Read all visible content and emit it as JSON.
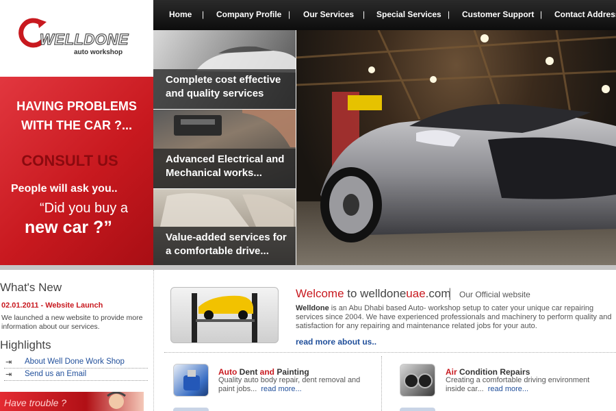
{
  "brand": {
    "name": "WELLDONE",
    "tagline": "auto workshop",
    "red": "#c8191f",
    "dark": "#1a1a1a",
    "link": "#1f4e9a"
  },
  "nav": {
    "items": [
      "Home",
      "Company Profile",
      "Our Services",
      "Special Services",
      "Customer Support",
      "Contact Address"
    ],
    "separator": "|"
  },
  "promo": {
    "line1": "HAVING PROBLEMS",
    "line2": "WITH THE CAR ?...",
    "consult": "CONSULT US",
    "ask": "People will ask you..",
    "quote1": "“Did you buy a",
    "quote2": "new car ?”"
  },
  "features": [
    {
      "caption": "Complete cost effective and quality services"
    },
    {
      "caption": "Advanced Electrical and Mechanical works..."
    },
    {
      "caption": "Value-added services for a comfortable drive..."
    }
  ],
  "sidebar": {
    "whats_new_title": "What's New",
    "news_date": "02.01.2011 - Website Launch",
    "news_body": "We launched a new website to provide more information about our services.",
    "highlights_title": "Highlights",
    "highlights": [
      "About Well Done Work Shop",
      "Send us an Email"
    ],
    "trouble_text": "Have trouble ?"
  },
  "welcome": {
    "title_welcome": "Welcome",
    "title_to": " to welldone",
    "title_uae": "uae",
    "title_com": ".com",
    "bar": "|",
    "subtitle": "Our Official website",
    "brand_bold": "Welldone",
    "body": " is an Abu Dhabi based Auto- workshop setup to cater your unique car repairing services since 2004. We have experienced professionals and machinery to perform quality and satisfaction for any repairing and maintenance related jobs for your auto.",
    "read_more": "read more about us.."
  },
  "services": [
    {
      "title_red": "Auto ",
      "title_dark": "Dent",
      "title_red2": " and ",
      "title_dark2": "Painting",
      "desc": "Quality auto body repair, dent removal and paint jobs...",
      "more": "read more..."
    },
    {
      "title_red": "Air ",
      "title_dark": "Condition",
      "title_red2": " ",
      "title_dark2": "Repairs",
      "desc": "Creating a comfortable driving environment inside car...",
      "more": "read more..."
    }
  ]
}
